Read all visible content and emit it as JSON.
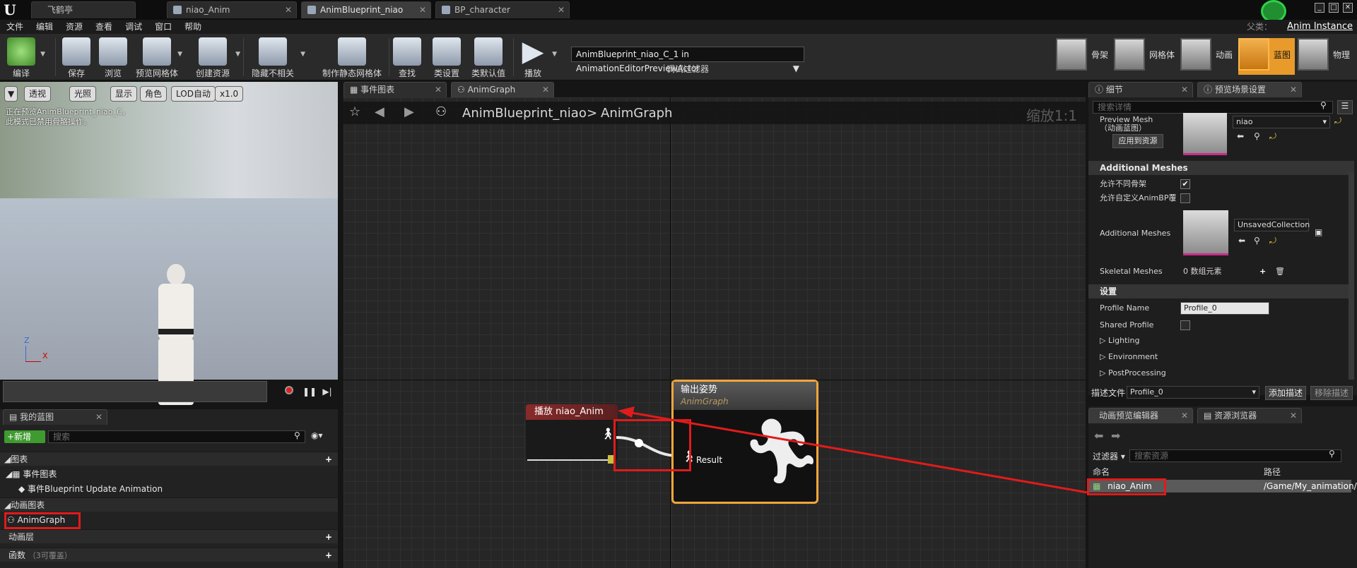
{
  "title_tabs": [
    {
      "label": "飞鹤亭",
      "active": false
    },
    {
      "label": "niao_Anim",
      "active": false
    },
    {
      "label": "AnimBlueprint_niao",
      "active": true
    },
    {
      "label": "BP_character",
      "active": false
    }
  ],
  "menu": [
    "文件",
    "编辑",
    "资源",
    "查看",
    "调试",
    "窗口",
    "帮助"
  ],
  "parent": {
    "label": "父类：",
    "value": "Anim Instance"
  },
  "toolbar": {
    "buttons": [
      {
        "label": "编译",
        "icon": "compile-icon"
      },
      {
        "label": "保存",
        "icon": "save-icon"
      },
      {
        "label": "浏览",
        "icon": "browse-icon"
      },
      {
        "label": "预览网格体",
        "icon": "preview-mesh-icon"
      },
      {
        "label": "创建资源",
        "icon": "create-asset-icon"
      },
      {
        "label": "隐藏不相关",
        "icon": "hide-unrelated-icon"
      },
      {
        "label": "制作静态网格体",
        "icon": "make-static-mesh-icon"
      },
      {
        "label": "查找",
        "icon": "find-icon"
      },
      {
        "label": "类设置",
        "icon": "class-settings-icon"
      },
      {
        "label": "类默认值",
        "icon": "class-defaults-icon"
      },
      {
        "label": "播放",
        "icon": "play-icon"
      }
    ],
    "debug_selected": "AnimBlueprint_niao_C_1 in AnimationEditorPreviewActor",
    "debug_label": "调试过滤器",
    "modes": [
      {
        "label": "骨架",
        "active": false
      },
      {
        "label": "网格体",
        "active": false
      },
      {
        "label": "动画",
        "active": false
      },
      {
        "label": "蓝图",
        "active": true
      },
      {
        "label": "物理",
        "active": false
      }
    ]
  },
  "viewport": {
    "buttons": [
      "透视",
      "光照",
      "显示",
      "角色",
      "LOD自动",
      "x1.0"
    ],
    "overlay_text": [
      "正在预览AnimBlueprint_niao_C，",
      "此模式已禁用骨骼操作。"
    ],
    "axis": {
      "z": "Z",
      "x": "X"
    }
  },
  "my_blueprint": {
    "tab": "我的蓝图",
    "new_label": "+新增",
    "search_placeholder": "搜索",
    "sections": {
      "graphs": "图表",
      "event_graph": "事件图表",
      "event_item": "事件Blueprint Update Animation",
      "anim_graphs": "动画图表",
      "anim_graph_item": "AnimGraph",
      "anim_layers": "动画层",
      "functions": "函数",
      "functions_note": "（3可覆盖）"
    }
  },
  "graph": {
    "tabs": [
      "事件图表",
      "AnimGraph"
    ],
    "breadcrumb": [
      "AnimBlueprint_niao",
      ">",
      "AnimGraph"
    ],
    "zoom": "缩放1:1",
    "play_node": "播放 niao_Anim",
    "output_node": {
      "title": "输出姿势",
      "subtitle": "AnimGraph",
      "pin": "Result"
    }
  },
  "details": {
    "tabs": [
      "细节",
      "预览场景设置"
    ],
    "search_placeholder": "搜索详情",
    "preview_mesh_label": "Preview Mesh\n（动画蓝图）",
    "apply_button": "应用到资源",
    "mesh_value": "niao",
    "section_additional": "Additional Meshes",
    "allow_diff_skeleton": "允许不同骨架",
    "allow_custom_bp": "允许自定义AnimBP覆",
    "additional_meshes_label": "Additional Meshes",
    "additional_meshes_value": "UnsavedCollection",
    "skeletal_meshes_label": "Skeletal Meshes",
    "skeletal_meshes_value": "0 数组元素",
    "section_settings": "设置",
    "profile_name_label": "Profile Name",
    "profile_name_value": "Profile_0",
    "shared_profile_label": "Shared Profile",
    "lighting": "Lighting",
    "environment": "Environment",
    "postprocessing": "PostProcessing",
    "desc_file_label": "描述文件",
    "desc_file_value": "Profile_0",
    "add_desc": "添加描述",
    "remove_desc": "移除描述"
  },
  "assets": {
    "tabs": [
      "动画预览编辑器",
      "资源浏览器"
    ],
    "filter_label": "过滤器",
    "search_placeholder": "搜索资源",
    "col_name": "命名",
    "col_path": "路径",
    "row_name": "niao_Anim",
    "row_path": "/Game/My_animation/"
  },
  "colors": {
    "accent": "#f2a63a",
    "highlight": "#e01b1b",
    "new_button": "#3f9b2f"
  }
}
